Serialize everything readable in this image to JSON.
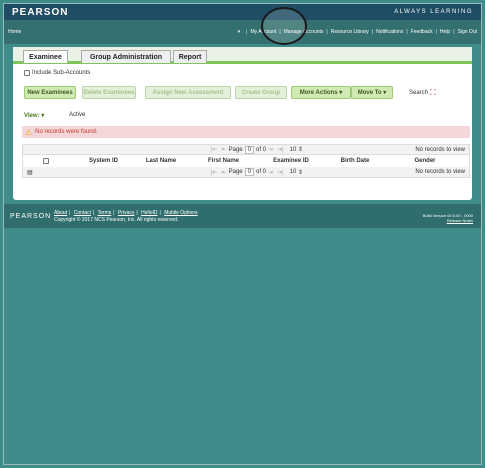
{
  "brand": {
    "logo": "PEARSON",
    "tagline": "ALWAYS LEARNING"
  },
  "nav": {
    "home": "Home",
    "dropdown_arrow": "▾",
    "links": [
      "My Account",
      "Manage Accounts",
      "Resource Library",
      "Notifications",
      "Feedback",
      "Help",
      "Sign Out"
    ]
  },
  "tabs": [
    {
      "label": "Examinee",
      "active": true
    },
    {
      "label": "Group Administration",
      "active": false
    },
    {
      "label": "Report",
      "active": false
    }
  ],
  "include_sub_accounts": {
    "label": "Include Sub-Accounts",
    "checked": false
  },
  "toolbar": {
    "new_examinees": "New Examinees",
    "delete_examinees": "Delete Examinees",
    "assign_new_assessment": "Assign New Assessment",
    "create_group": "Create Group",
    "more_actions": "More Actions",
    "move_to": "Move To",
    "search": "Search"
  },
  "view": {
    "label": "View:",
    "value": "Active"
  },
  "alert": {
    "message": "No records were found."
  },
  "grid": {
    "pager": {
      "page_label": "Page",
      "page_value": "0",
      "of_label": "of 0",
      "page_size": "10"
    },
    "records_text": "No records to view",
    "columns": [
      "System ID",
      "Last Name",
      "First Name",
      "Examinee ID",
      "Birth Date",
      "Gender"
    ]
  },
  "footer": {
    "logo": "PEARSON",
    "links": [
      "About",
      "Contact",
      "Terms",
      "Privacy",
      "HelloID",
      "Mobile Options"
    ],
    "copyright": "Copyright © 2017 NCS Pearson, Inc. All rights reserved.",
    "build": "Build Version 00.0.00 - 0000",
    "release_notes": "Release Notes"
  },
  "colors": {
    "background": "#3f8d8a",
    "brand_bar": "#1f4d63",
    "accent_green": "#7fc65a",
    "alert_bg": "#f5d6d8"
  }
}
